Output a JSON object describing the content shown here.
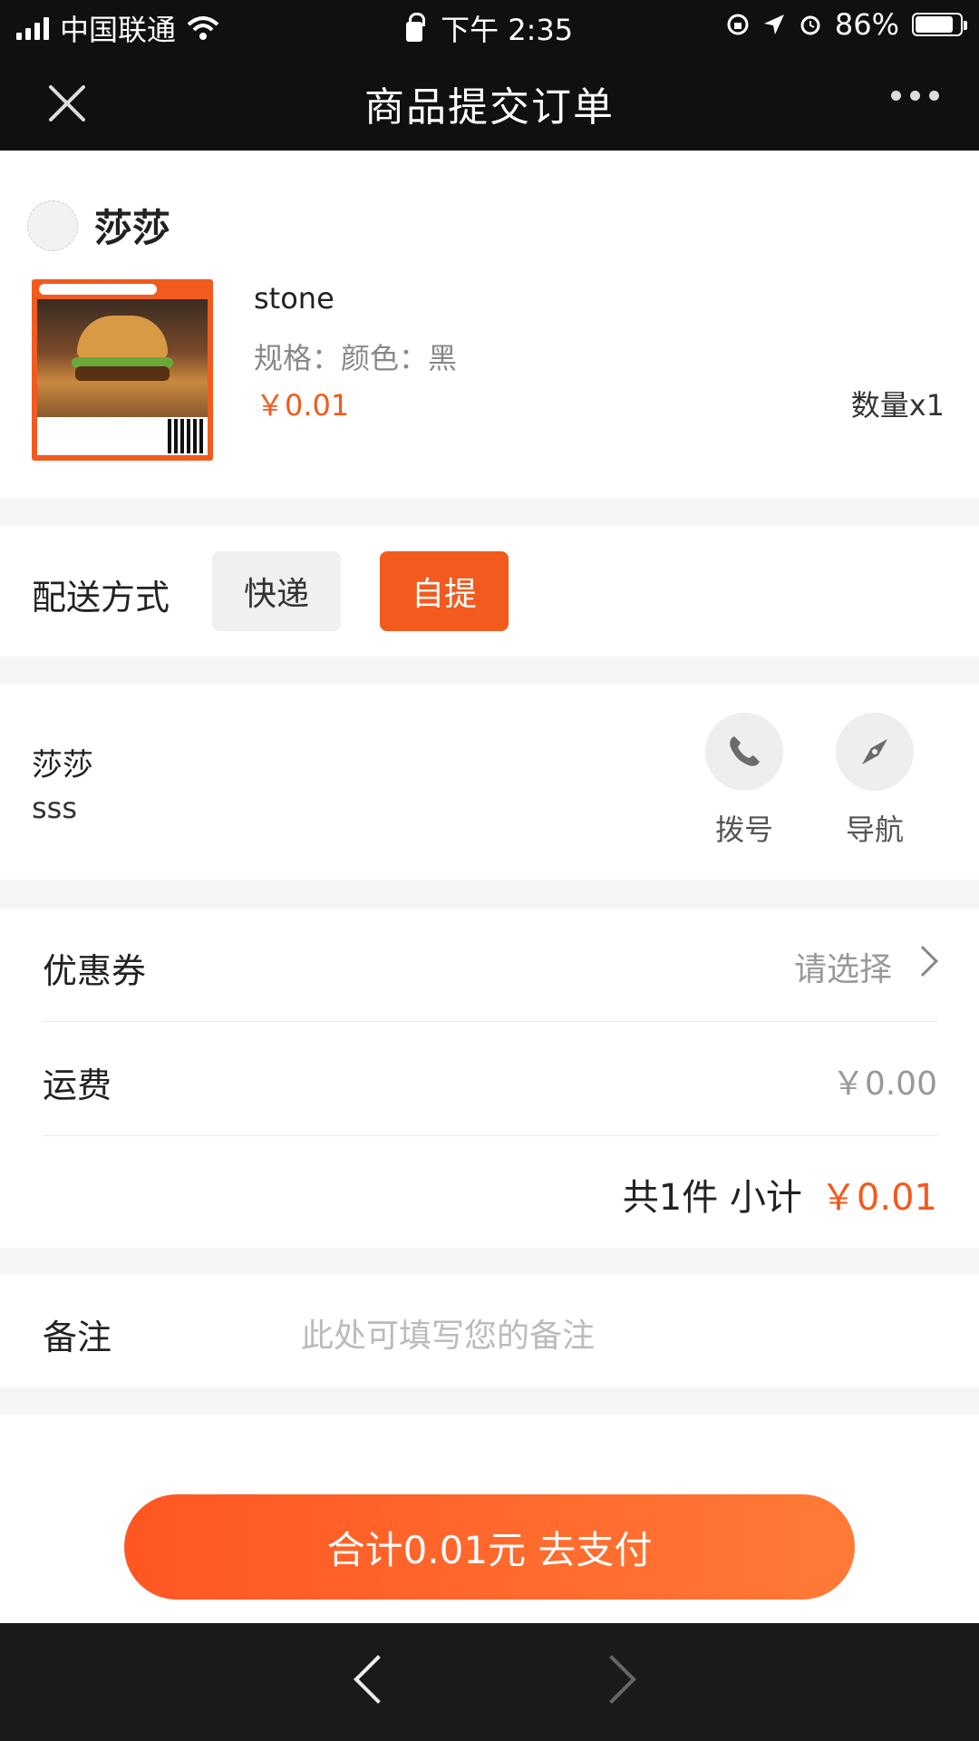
{
  "status_bar": {
    "carrier": "中国联通",
    "time": "下午 2:35",
    "battery": "86%",
    "battery_level": 0.86
  },
  "nav": {
    "title": "商品提交订单",
    "icons": {
      "close": "close-icon",
      "more": "more-icon"
    }
  },
  "shop": {
    "name": "莎莎",
    "product": {
      "name": "stone",
      "spec": "规格：颜色：黑",
      "price": "￥0.01",
      "quantity": "数量x1"
    }
  },
  "delivery": {
    "label": "配送方式",
    "options": [
      {
        "label": "快递",
        "selected": false
      },
      {
        "label": "自提",
        "selected": true
      }
    ]
  },
  "store": {
    "name": "莎莎",
    "address": "sss",
    "actions": [
      {
        "label": "拨号",
        "icon": "phone-icon"
      },
      {
        "label": "导航",
        "icon": "compass-icon"
      }
    ]
  },
  "summary": {
    "coupon_label": "优惠券",
    "coupon_value": "请选择",
    "shipping_label": "运费",
    "shipping_value": "￥0.00",
    "subtotal_text": "共1件 小计",
    "subtotal_price": "￥0.01"
  },
  "remark": {
    "label": "备注",
    "placeholder": "此处可填写您的备注"
  },
  "pay": {
    "button_label": "合计0.01元 去支付"
  },
  "colors": {
    "accent": "#f25a1e",
    "nav_bg": "#101010"
  }
}
